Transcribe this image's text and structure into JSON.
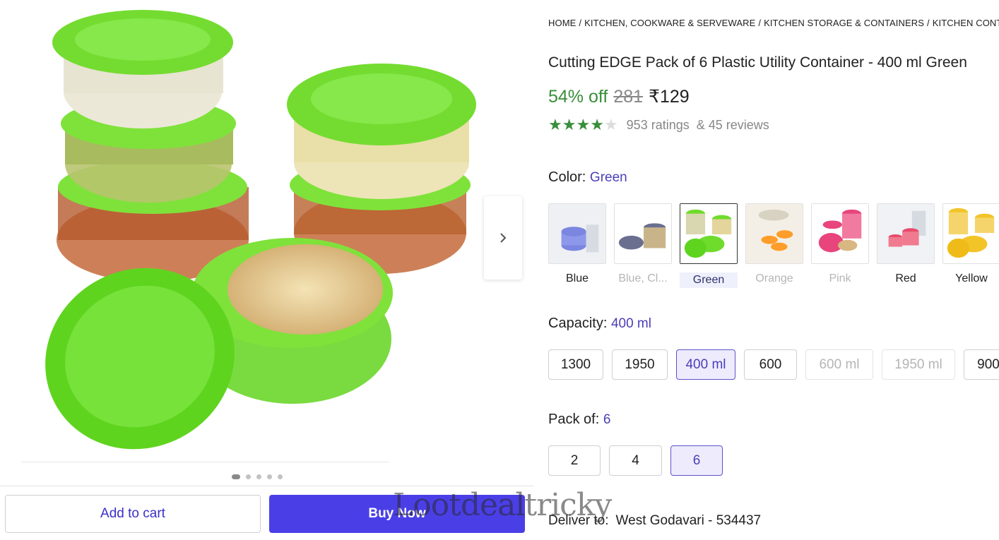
{
  "breadcrumb": [
    "HOME",
    "KITCHEN, COOKWARE & SERVEWARE",
    "KITCHEN STORAGE & CONTAINERS",
    "KITCHEN CONTAINERS"
  ],
  "product": {
    "title": "Cutting EDGE Pack of 6 Plastic Utility Container  - 400 ml Green",
    "discount": "54% off",
    "mrp": "281",
    "price": "₹129",
    "rating_value": 4,
    "rating_max": 5,
    "ratings_text": "953 ratings",
    "reviews_text": "& 45 reviews"
  },
  "color": {
    "label": "Color:",
    "selected": "Green",
    "options": [
      {
        "label": "Blue",
        "state": "available",
        "tint": "#7a86e0"
      },
      {
        "label": "Blue, Cl...",
        "state": "disabled",
        "tint": "#6a6f8f"
      },
      {
        "label": "Green",
        "state": "selected",
        "tint": "#6fdc2c"
      },
      {
        "label": "Orange",
        "state": "disabled",
        "tint": "#ff9d2a"
      },
      {
        "label": "Pink",
        "state": "disabled",
        "tint": "#e8457c"
      },
      {
        "label": "Red",
        "state": "available",
        "tint": "#e84a6a"
      },
      {
        "label": "Yellow",
        "state": "available",
        "tint": "#f3c428"
      }
    ]
  },
  "capacity": {
    "label": "Capacity:",
    "selected": "400 ml",
    "options": [
      {
        "label": "1300",
        "state": "available"
      },
      {
        "label": "1950",
        "state": "available"
      },
      {
        "label": "400 ml",
        "state": "selected"
      },
      {
        "label": "600",
        "state": "available"
      },
      {
        "label": "600 ml",
        "state": "disabled"
      },
      {
        "label": "1950 ml",
        "state": "disabled"
      },
      {
        "label": "900",
        "state": "available"
      }
    ]
  },
  "pack": {
    "label": "Pack of:",
    "selected": "6",
    "options": [
      {
        "label": "2",
        "state": "available"
      },
      {
        "label": "4",
        "state": "available"
      },
      {
        "label": "6",
        "state": "selected"
      }
    ]
  },
  "deliver": {
    "label": "Deliver to:",
    "place": "West Godavari - 534437"
  },
  "actions": {
    "add_to_cart": "Add to cart",
    "buy_now": "Buy Now"
  },
  "gallery": {
    "image_count": 5,
    "active_index": 0
  },
  "watermark": "Lootdealtricky",
  "colors": {
    "accent": "#4a3fe7",
    "discount_green": "#388e3c",
    "lid_green": "#6fdc2c"
  }
}
